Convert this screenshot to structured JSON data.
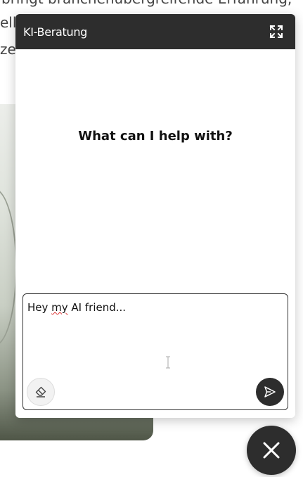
{
  "background": {
    "text_lines": [
      "bringt branchenübergreifende Erfahrung,",
      "elle",
      "zer"
    ]
  },
  "chat": {
    "title": "KI-Beratung",
    "heading": "What can I help with?",
    "input": {
      "value_prefix": "Hey ",
      "value_misspelled": "my",
      "value_suffix": " AI friend..."
    }
  },
  "colors": {
    "header_bg": "#2d2d2d",
    "header_text": "#ffffff",
    "send_button_bg": "#2d2d2d",
    "close_button_bg": "#2d2d2d"
  },
  "icons": {
    "expand": "expand-arrows-icon",
    "clear": "eraser-icon",
    "send": "send-paper-plane-icon",
    "close": "close-x-icon",
    "caret": "text-cursor-icon"
  }
}
